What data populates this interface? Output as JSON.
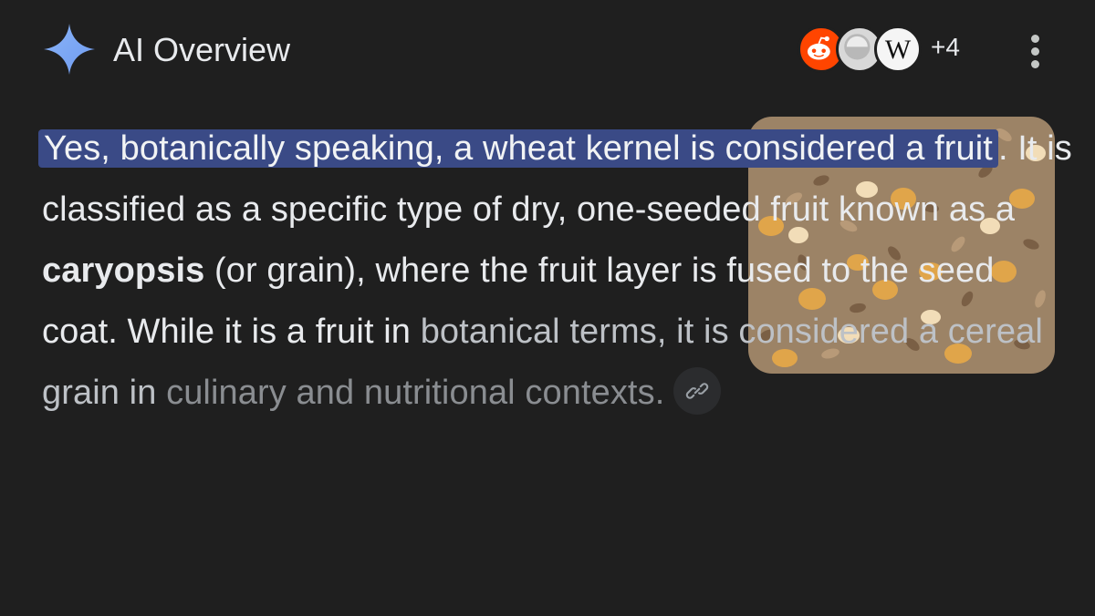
{
  "header": {
    "title": "AI Overview",
    "sources_more": "+4",
    "source_icons": [
      "reddit-icon",
      "source-icon",
      "wikipedia-icon"
    ],
    "wiki_letter": "W"
  },
  "answer": {
    "highlight": "Yes, botanically speaking, a wheat kernel is considered a fruit",
    "line1_rest": ". It is classified as a specific type of dry, one-seeded fruit known as a ",
    "bold_term": "caryopsis",
    "line2": " (or grain), where the fruit layer is fused to the seed coat. While it is a fruit in ",
    "line3": "botanical terms, it is considered a cereal grain in ",
    "line4": "culinary and nutritional contexts."
  },
  "colors": {
    "background": "#1f1f1f",
    "highlight": "#3a4a86",
    "accent": "#8ab4f8"
  }
}
